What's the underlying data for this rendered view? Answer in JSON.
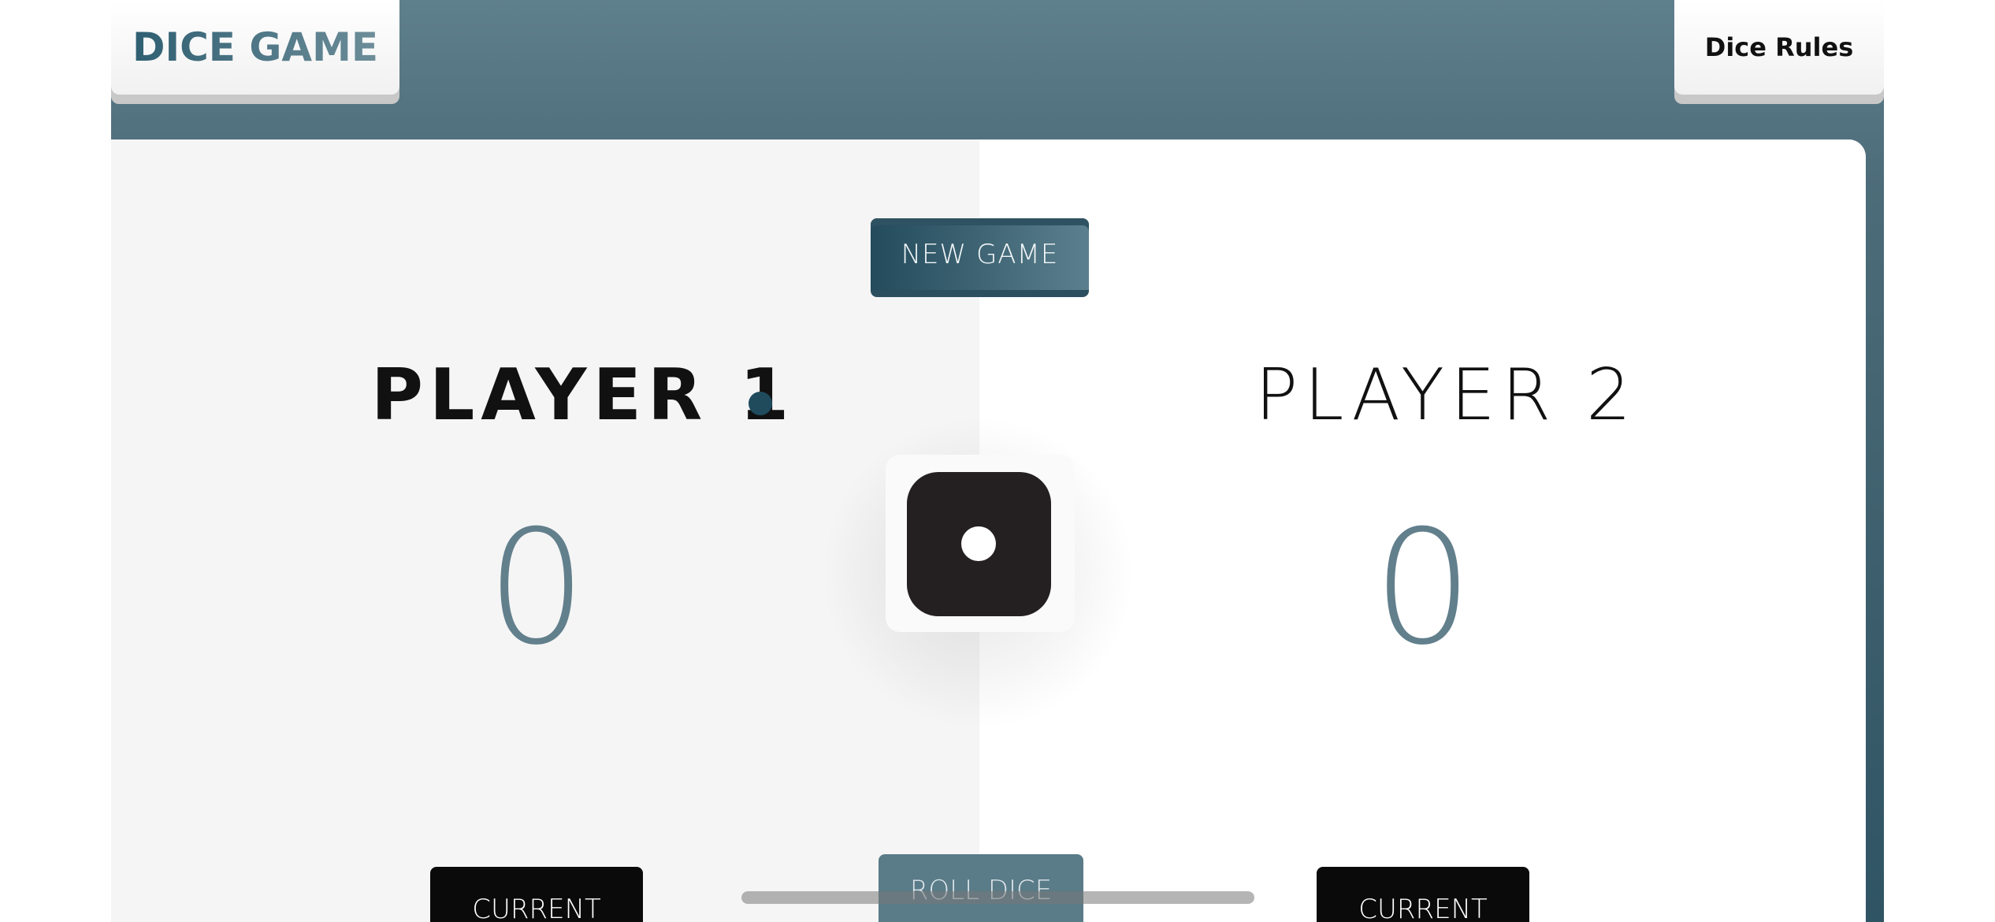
{
  "header": {
    "logo_text": "DICE GAME",
    "rules_label": "Dice Rules"
  },
  "controls": {
    "new_game_label": "NEW GAME",
    "roll_dice_label": "ROLL DICE"
  },
  "players": [
    {
      "name": "PLAYER 1",
      "score": "0",
      "current_label": "CURRENT",
      "active": true
    },
    {
      "name": "PLAYER 2",
      "score": "0",
      "current_label": "CURRENT",
      "active": false
    }
  ],
  "dice": {
    "face_value": 1,
    "icon": "dice-one-icon"
  },
  "colors": {
    "accent": "#1f4b5d",
    "score_text": "#627f8c",
    "frame": "#4d6c79",
    "dice_body": "#242021"
  }
}
